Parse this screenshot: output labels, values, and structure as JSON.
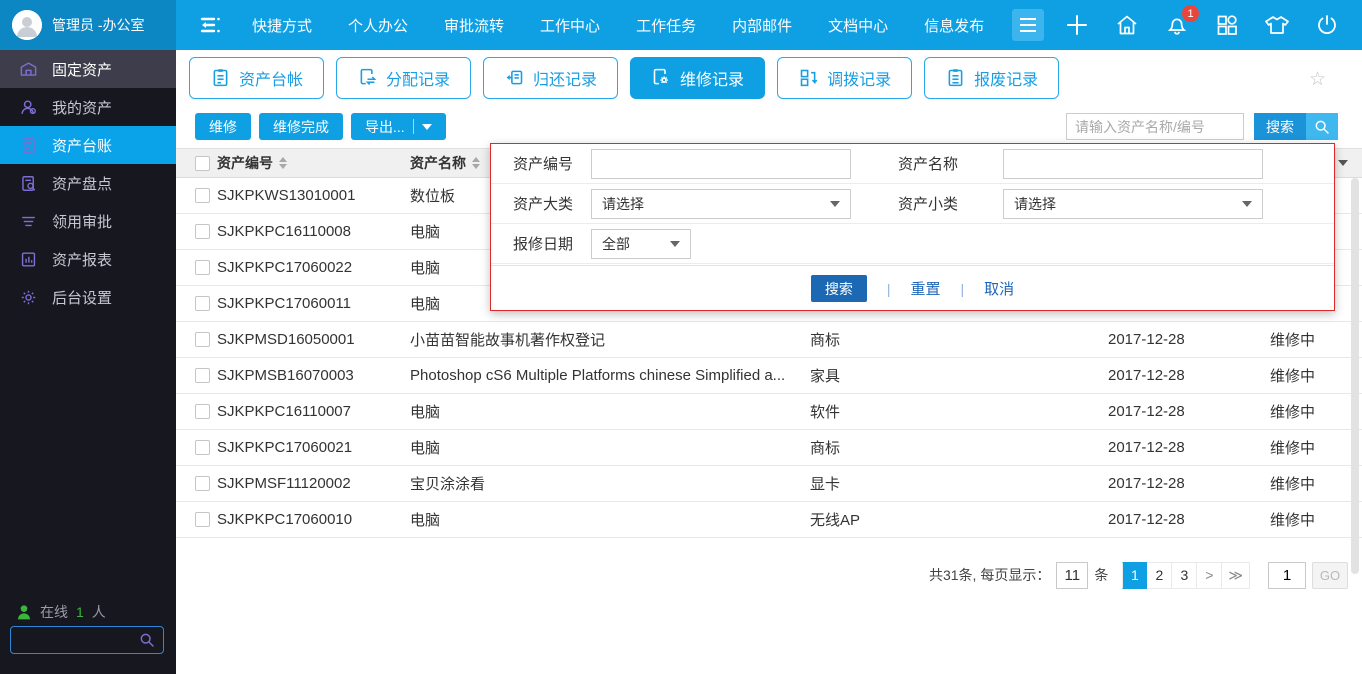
{
  "topbar": {
    "user": "管理员 -办公室",
    "nav": [
      "快捷方式",
      "个人办公",
      "审批流转",
      "工作中心",
      "工作任务",
      "内部邮件",
      "文档中心",
      "信息发布"
    ],
    "notification_count": "1"
  },
  "sidebar": {
    "module": "固定资产",
    "items": [
      {
        "label": "我的资产",
        "icon": "person-icon",
        "active": false
      },
      {
        "label": "资产台账",
        "icon": "ledger-icon",
        "active": true
      },
      {
        "label": "资产盘点",
        "icon": "inventory-icon",
        "active": false
      },
      {
        "label": "领用审批",
        "icon": "approval-icon",
        "active": false
      },
      {
        "label": "资产报表",
        "icon": "report-icon",
        "active": false
      },
      {
        "label": "后台设置",
        "icon": "settings-icon",
        "active": false
      }
    ],
    "online_label": "在线",
    "online_count": "1",
    "online_unit": "人"
  },
  "tabs": [
    {
      "label": "资产台帐",
      "icon": "ledger-tab-icon",
      "active": false
    },
    {
      "label": "分配记录",
      "icon": "assign-icon",
      "active": false
    },
    {
      "label": "归还记录",
      "icon": "return-icon",
      "active": false
    },
    {
      "label": "维修记录",
      "icon": "repair-icon",
      "active": true
    },
    {
      "label": "调拨记录",
      "icon": "transfer-icon",
      "active": false
    },
    {
      "label": "报废记录",
      "icon": "scrap-icon",
      "active": false
    }
  ],
  "toolbar": {
    "repair_label": "维修",
    "repair_done_label": "维修完成",
    "export_label": "导出...",
    "search_placeholder": "请输入资产名称/编号",
    "search_label": "搜索"
  },
  "filter_popup": {
    "asset_no_label": "资产编号",
    "asset_name_label": "资产名称",
    "asset_major_label": "资产大类",
    "asset_minor_label": "资产小类",
    "repair_date_label": "报修日期",
    "select_placeholder": "请选择",
    "date_all": "全部",
    "search_label": "搜索",
    "reset_label": "重置",
    "cancel_label": "取消"
  },
  "table": {
    "headers": {
      "id": "资产编号",
      "name": "资产名称"
    },
    "rows": [
      {
        "id": "SJKPKWS13010001",
        "name": "数位板",
        "category": "",
        "date": "",
        "status": ""
      },
      {
        "id": "SJKPKPC16110008",
        "name": "电脑",
        "category": "",
        "date": "",
        "status": ""
      },
      {
        "id": "SJKPKPC17060022",
        "name": "电脑",
        "category": "",
        "date": "",
        "status": ""
      },
      {
        "id": "SJKPKPC17060011",
        "name": "电脑",
        "category": "",
        "date": "",
        "status": ""
      },
      {
        "id": "SJKPMSD16050001",
        "name": "小苗苗智能故事机著作权登记",
        "category": "商标",
        "date": "2017-12-28",
        "status": "维修中"
      },
      {
        "id": "SJKPMSB16070003",
        "name": "Photoshop cS6 Multiple Platforms chinese Simplified a...",
        "category": "家具",
        "date": "2017-12-28",
        "status": "维修中"
      },
      {
        "id": "SJKPKPC16110007",
        "name": "电脑",
        "category": "软件",
        "date": "2017-12-28",
        "status": "维修中"
      },
      {
        "id": "SJKPKPC17060021",
        "name": "电脑",
        "category": "商标",
        "date": "2017-12-28",
        "status": "维修中"
      },
      {
        "id": "SJKPMSF11120002",
        "name": "宝贝涂涂看",
        "category": "显卡",
        "date": "2017-12-28",
        "status": "维修中"
      },
      {
        "id": "SJKPKPC17060010",
        "name": "电脑",
        "category": "无线AP",
        "date": "2017-12-28",
        "status": "维修中"
      }
    ]
  },
  "pagination": {
    "summary": "共31条, 每页显示：",
    "per_page": "11",
    "unit": "条",
    "pages": [
      "1",
      "2",
      "3"
    ],
    "active_page": "1",
    "next_label": ">",
    "last_label": "≫",
    "goto_value": "1",
    "go_label": "GO"
  },
  "colors": {
    "topbar_blue": "#0fa0e4",
    "topbar_left_blue": "#0d86c4",
    "sidebar_bg": "#17171f",
    "active_blue": "#0aa2e8",
    "popup_border_red": "#dc2a2a",
    "popup_button_blue": "#1d68b3",
    "sidebar_icon_purple": "#7b6fd4",
    "online_green": "#3cb53c",
    "badge_red": "#e8463c"
  }
}
